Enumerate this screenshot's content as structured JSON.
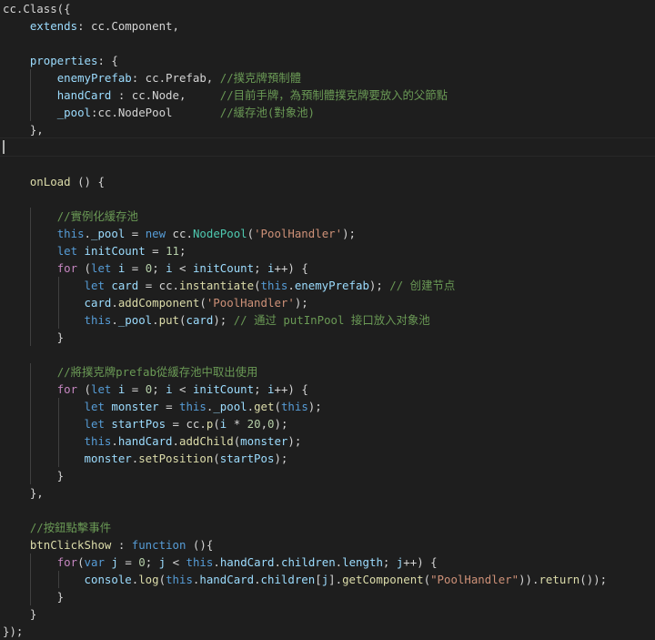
{
  "editor": {
    "language": "javascript",
    "current_line": 8,
    "theme_colors": {
      "background": "#1e1e1e",
      "plain": "#d4d4d4",
      "property": "#9cdcfe",
      "keyword": "#569cd6",
      "control": "#c586c0",
      "function": "#dcdcaa",
      "class": "#4ec9b0",
      "string": "#ce9178",
      "number": "#b5cea8",
      "comment": "#6a9955"
    },
    "lines": [
      [
        [
          "plain",
          "cc.Class({"
        ]
      ],
      [
        [
          "plain",
          "    "
        ],
        [
          "prop",
          "extends"
        ],
        [
          "plain",
          ": cc.Component,"
        ]
      ],
      [
        [
          "plain",
          ""
        ]
      ],
      [
        [
          "plain",
          "    "
        ],
        [
          "prop",
          "properties"
        ],
        [
          "plain",
          ": {"
        ]
      ],
      [
        [
          "plain",
          "        "
        ],
        [
          "prop",
          "enemyPrefab"
        ],
        [
          "plain",
          ": cc.Prefab, "
        ],
        [
          "cmt",
          "//撲克牌預制體"
        ]
      ],
      [
        [
          "plain",
          "        "
        ],
        [
          "prop",
          "handCard"
        ],
        [
          "plain",
          " : cc.Node,     "
        ],
        [
          "cmt",
          "//目前手牌，為預制體撲克牌要放入的父節點"
        ]
      ],
      [
        [
          "plain",
          "        "
        ],
        [
          "prop",
          "_pool"
        ],
        [
          "plain",
          ":cc.NodePool       "
        ],
        [
          "cmt",
          "//緩存池(對象池)"
        ]
      ],
      [
        [
          "plain",
          "    },"
        ]
      ],
      [
        [
          "plain",
          ""
        ]
      ],
      [
        [
          "plain",
          ""
        ]
      ],
      [
        [
          "plain",
          "    "
        ],
        [
          "fn",
          "onLoad"
        ],
        [
          "plain",
          " () {"
        ]
      ],
      [
        [
          "plain",
          ""
        ]
      ],
      [
        [
          "plain",
          "        "
        ],
        [
          "cmt",
          "//實例化緩存池"
        ]
      ],
      [
        [
          "plain",
          "        "
        ],
        [
          "kw",
          "this"
        ],
        [
          "plain",
          "."
        ],
        [
          "prop",
          "_pool"
        ],
        [
          "plain",
          " = "
        ],
        [
          "kw",
          "new"
        ],
        [
          "plain",
          " cc."
        ],
        [
          "class",
          "NodePool"
        ],
        [
          "plain",
          "("
        ],
        [
          "str",
          "'PoolHandler'"
        ],
        [
          "plain",
          ");"
        ]
      ],
      [
        [
          "plain",
          "        "
        ],
        [
          "kw",
          "let"
        ],
        [
          "plain",
          " "
        ],
        [
          "var",
          "initCount"
        ],
        [
          "plain",
          " = "
        ],
        [
          "num",
          "11"
        ],
        [
          "plain",
          ";"
        ]
      ],
      [
        [
          "plain",
          "        "
        ],
        [
          "ctrl",
          "for"
        ],
        [
          "plain",
          " ("
        ],
        [
          "kw",
          "let"
        ],
        [
          "plain",
          " "
        ],
        [
          "var",
          "i"
        ],
        [
          "plain",
          " = "
        ],
        [
          "num",
          "0"
        ],
        [
          "plain",
          "; "
        ],
        [
          "var",
          "i"
        ],
        [
          "plain",
          " < "
        ],
        [
          "var",
          "initCount"
        ],
        [
          "plain",
          "; "
        ],
        [
          "var",
          "i"
        ],
        [
          "plain",
          "++) {"
        ]
      ],
      [
        [
          "plain",
          "            "
        ],
        [
          "kw",
          "let"
        ],
        [
          "plain",
          " "
        ],
        [
          "var",
          "card"
        ],
        [
          "plain",
          " = cc."
        ],
        [
          "fn",
          "instantiate"
        ],
        [
          "plain",
          "("
        ],
        [
          "kw",
          "this"
        ],
        [
          "plain",
          "."
        ],
        [
          "prop",
          "enemyPrefab"
        ],
        [
          "plain",
          "); "
        ],
        [
          "cmt",
          "// 创建节点"
        ]
      ],
      [
        [
          "plain",
          "            "
        ],
        [
          "var",
          "card"
        ],
        [
          "plain",
          "."
        ],
        [
          "fn",
          "addComponent"
        ],
        [
          "plain",
          "("
        ],
        [
          "str",
          "'PoolHandler'"
        ],
        [
          "plain",
          ");"
        ]
      ],
      [
        [
          "plain",
          "            "
        ],
        [
          "kw",
          "this"
        ],
        [
          "plain",
          "."
        ],
        [
          "prop",
          "_pool"
        ],
        [
          "plain",
          "."
        ],
        [
          "fn",
          "put"
        ],
        [
          "plain",
          "("
        ],
        [
          "var",
          "card"
        ],
        [
          "plain",
          "); "
        ],
        [
          "cmt",
          "// 通过 putInPool 接口放入对象池"
        ]
      ],
      [
        [
          "plain",
          "        }"
        ]
      ],
      [
        [
          "plain",
          ""
        ]
      ],
      [
        [
          "plain",
          "        "
        ],
        [
          "cmt",
          "//將撲克牌prefab從緩存池中取出使用"
        ]
      ],
      [
        [
          "plain",
          "        "
        ],
        [
          "ctrl",
          "for"
        ],
        [
          "plain",
          " ("
        ],
        [
          "kw",
          "let"
        ],
        [
          "plain",
          " "
        ],
        [
          "var",
          "i"
        ],
        [
          "plain",
          " = "
        ],
        [
          "num",
          "0"
        ],
        [
          "plain",
          "; "
        ],
        [
          "var",
          "i"
        ],
        [
          "plain",
          " < "
        ],
        [
          "var",
          "initCount"
        ],
        [
          "plain",
          "; "
        ],
        [
          "var",
          "i"
        ],
        [
          "plain",
          "++) {"
        ]
      ],
      [
        [
          "plain",
          "            "
        ],
        [
          "kw",
          "let"
        ],
        [
          "plain",
          " "
        ],
        [
          "var",
          "monster"
        ],
        [
          "plain",
          " = "
        ],
        [
          "kw",
          "this"
        ],
        [
          "plain",
          "."
        ],
        [
          "prop",
          "_pool"
        ],
        [
          "plain",
          "."
        ],
        [
          "fn",
          "get"
        ],
        [
          "plain",
          "("
        ],
        [
          "kw",
          "this"
        ],
        [
          "plain",
          ");"
        ]
      ],
      [
        [
          "plain",
          "            "
        ],
        [
          "kw",
          "let"
        ],
        [
          "plain",
          " "
        ],
        [
          "var",
          "startPos"
        ],
        [
          "plain",
          " = cc."
        ],
        [
          "fn",
          "p"
        ],
        [
          "plain",
          "("
        ],
        [
          "var",
          "i"
        ],
        [
          "plain",
          " * "
        ],
        [
          "num",
          "20"
        ],
        [
          "plain",
          ","
        ],
        [
          "num",
          "0"
        ],
        [
          "plain",
          ");"
        ]
      ],
      [
        [
          "plain",
          "            "
        ],
        [
          "kw",
          "this"
        ],
        [
          "plain",
          "."
        ],
        [
          "prop",
          "handCard"
        ],
        [
          "plain",
          "."
        ],
        [
          "fn",
          "addChild"
        ],
        [
          "plain",
          "("
        ],
        [
          "var",
          "monster"
        ],
        [
          "plain",
          ");"
        ]
      ],
      [
        [
          "plain",
          "            "
        ],
        [
          "var",
          "monster"
        ],
        [
          "plain",
          "."
        ],
        [
          "fn",
          "setPosition"
        ],
        [
          "plain",
          "("
        ],
        [
          "var",
          "startPos"
        ],
        [
          "plain",
          ");"
        ]
      ],
      [
        [
          "plain",
          "        }"
        ]
      ],
      [
        [
          "plain",
          "    },"
        ]
      ],
      [
        [
          "plain",
          ""
        ]
      ],
      [
        [
          "plain",
          "    "
        ],
        [
          "cmt",
          "//按鈕點擊事件"
        ]
      ],
      [
        [
          "plain",
          "    "
        ],
        [
          "fn",
          "btnClickShow"
        ],
        [
          "plain",
          " : "
        ],
        [
          "kw",
          "function"
        ],
        [
          "plain",
          " (){"
        ]
      ],
      [
        [
          "plain",
          "        "
        ],
        [
          "ctrl",
          "for"
        ],
        [
          "plain",
          "("
        ],
        [
          "kw",
          "var"
        ],
        [
          "plain",
          " "
        ],
        [
          "var",
          "j"
        ],
        [
          "plain",
          " = "
        ],
        [
          "num",
          "0"
        ],
        [
          "plain",
          "; "
        ],
        [
          "var",
          "j"
        ],
        [
          "plain",
          " < "
        ],
        [
          "kw",
          "this"
        ],
        [
          "plain",
          "."
        ],
        [
          "prop",
          "handCard"
        ],
        [
          "plain",
          "."
        ],
        [
          "prop",
          "children"
        ],
        [
          "plain",
          "."
        ],
        [
          "prop",
          "length"
        ],
        [
          "plain",
          "; "
        ],
        [
          "var",
          "j"
        ],
        [
          "plain",
          "++) {"
        ]
      ],
      [
        [
          "plain",
          "            "
        ],
        [
          "var",
          "console"
        ],
        [
          "plain",
          "."
        ],
        [
          "fn",
          "log"
        ],
        [
          "plain",
          "("
        ],
        [
          "kw",
          "this"
        ],
        [
          "plain",
          "."
        ],
        [
          "prop",
          "handCard"
        ],
        [
          "plain",
          "."
        ],
        [
          "prop",
          "children"
        ],
        [
          "plain",
          "["
        ],
        [
          "var",
          "j"
        ],
        [
          "plain",
          "]."
        ],
        [
          "fn",
          "getComponent"
        ],
        [
          "plain",
          "("
        ],
        [
          "str",
          "\"PoolHandler\""
        ],
        [
          "plain",
          "))."
        ],
        [
          "fn",
          "return"
        ],
        [
          "plain",
          "());"
        ]
      ],
      [
        [
          "plain",
          "        }"
        ]
      ],
      [
        [
          "plain",
          "    }"
        ]
      ],
      [
        [
          "plain",
          "});"
        ]
      ]
    ]
  }
}
